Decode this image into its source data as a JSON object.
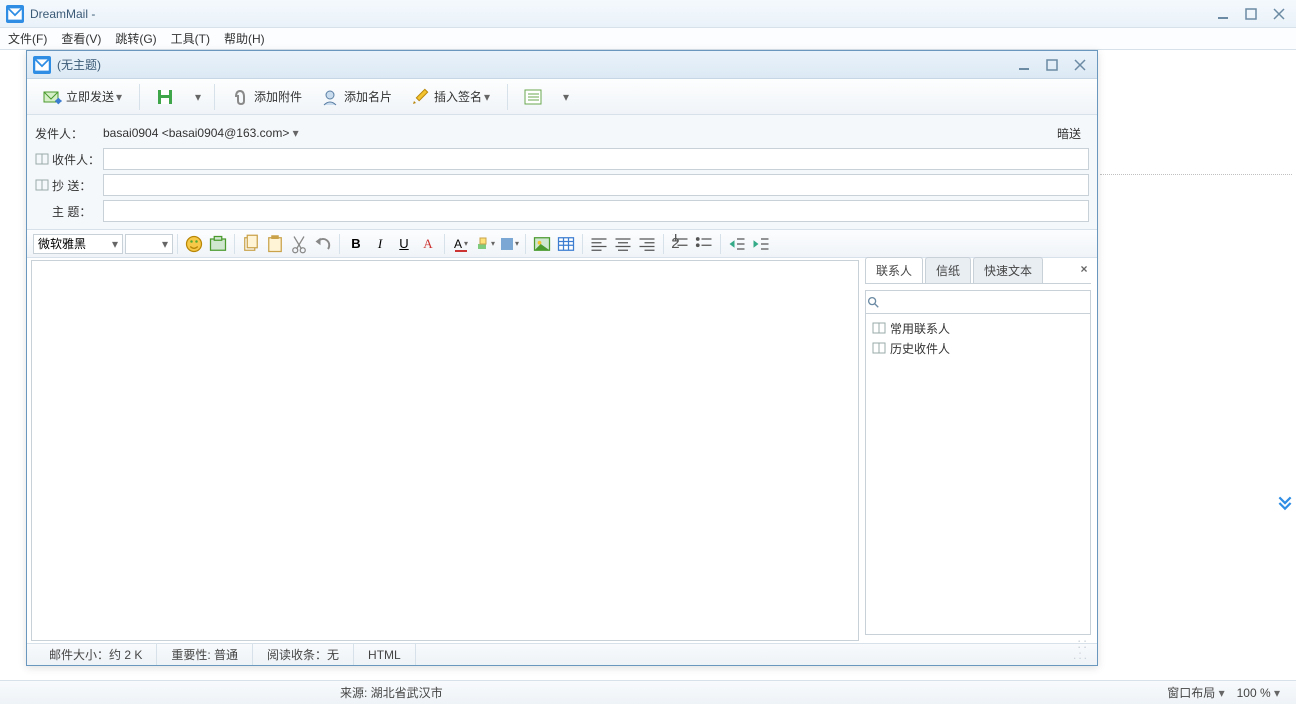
{
  "app": {
    "title": "DreamMail -"
  },
  "menu": {
    "file": "文件(F)",
    "view": "查看(V)",
    "goto": "跳转(G)",
    "tools": "工具(T)",
    "help": "帮助(H)"
  },
  "compose": {
    "title": "(无主题)",
    "toolbar": {
      "send": "立即发送",
      "attach": "添加附件",
      "vcard": "添加名片",
      "signature": "插入签名"
    },
    "headers": {
      "from_label": "发件人：",
      "from_value": "basai0904 <basai0904@163.com>",
      "bcc_label": "暗送",
      "to_label": "收件人：",
      "cc_label": "抄  送：",
      "subject_label": "主  题："
    },
    "format": {
      "font": "微软雅黑"
    },
    "side": {
      "tabs": {
        "contacts": "联系人",
        "stationery": "信纸",
        "quicktext": "快速文本"
      },
      "items": {
        "freq": "常用联系人",
        "history": "历史收件人"
      }
    },
    "status": {
      "size": "邮件大小：约 2 K",
      "importance": "重要性: 普通",
      "receipt": "阅读收条：无",
      "mode": "HTML"
    }
  },
  "footer": {
    "source": "来源: 湖北省武汉市",
    "layout": "窗口布局",
    "zoom": "100 %"
  }
}
